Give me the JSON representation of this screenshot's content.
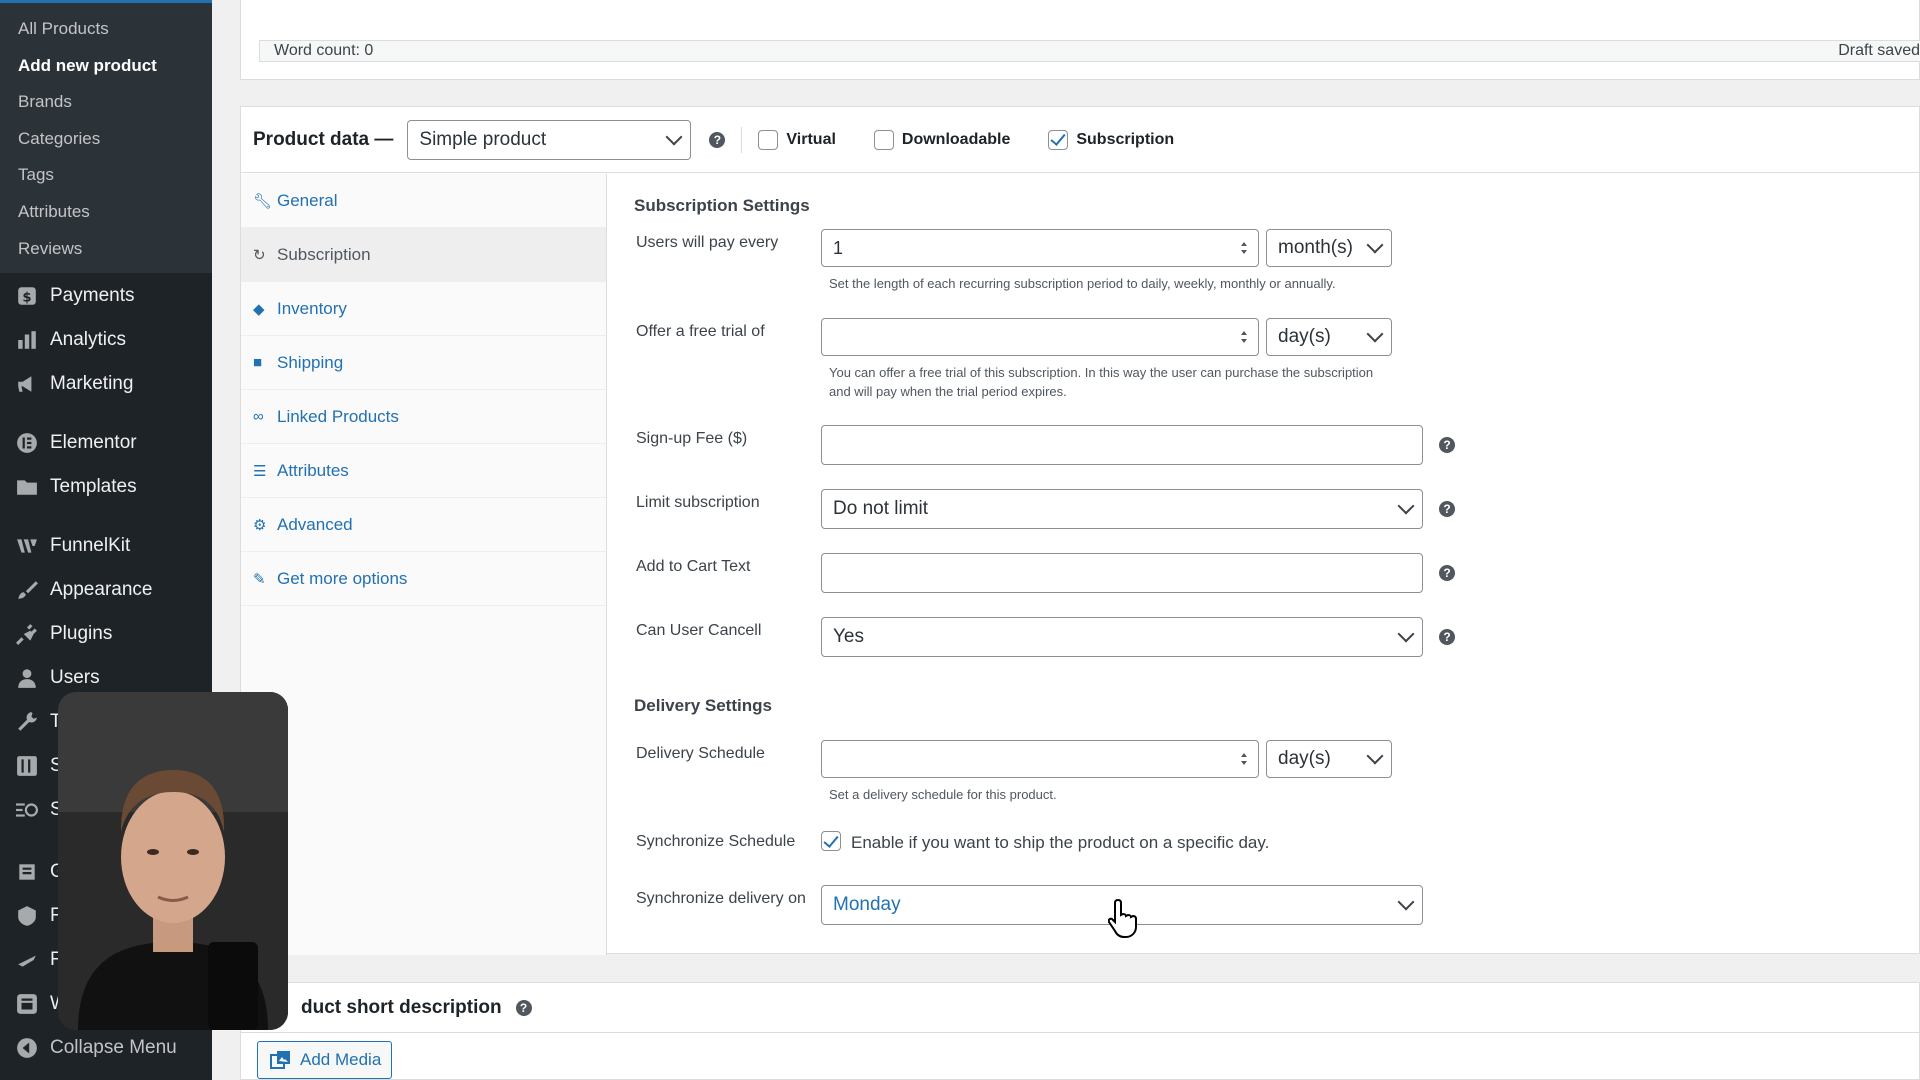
{
  "sidebar": {
    "submenu": [
      {
        "label": "All Products"
      },
      {
        "label": "Add new product"
      },
      {
        "label": "Brands"
      },
      {
        "label": "Categories"
      },
      {
        "label": "Tags"
      },
      {
        "label": "Attributes"
      },
      {
        "label": "Reviews"
      }
    ],
    "menu": [
      {
        "label": "Payments",
        "icon": "dollar-icon"
      },
      {
        "label": "Analytics",
        "icon": "bar-chart-icon"
      },
      {
        "label": "Marketing",
        "icon": "megaphone-icon"
      },
      {
        "label": "Elementor",
        "icon": "elementor-icon"
      },
      {
        "label": "Templates",
        "icon": "folder-icon"
      },
      {
        "label": "FunnelKit",
        "icon": "funnelkit-icon"
      },
      {
        "label": "Appearance",
        "icon": "paintbrush-icon"
      },
      {
        "label": "Plugins",
        "icon": "plug-icon"
      },
      {
        "label": "Users",
        "icon": "user-icon"
      },
      {
        "label": "T",
        "icon": "wrench-icon"
      },
      {
        "label": "S",
        "icon": "settings-icon"
      },
      {
        "label": "S",
        "icon": "toggle-icon"
      },
      {
        "label": "G",
        "icon": "g-icon"
      },
      {
        "label": "F",
        "icon": "f-icon"
      },
      {
        "label": "F",
        "icon": "feather-icon"
      },
      {
        "label": "W",
        "icon": "w-icon"
      },
      {
        "label": "Collapse Menu",
        "icon": "collapse-icon"
      }
    ]
  },
  "editor": {
    "word_count": "Word count: 0",
    "draft_status": "Draft saved"
  },
  "product_data": {
    "title": "Product data —",
    "product_type": "Simple product",
    "checkboxes": [
      {
        "label": "Virtual",
        "checked": false
      },
      {
        "label": "Downloadable",
        "checked": false
      },
      {
        "label": "Subscription",
        "checked": true
      }
    ],
    "tabs": [
      {
        "label": "General",
        "icon": "wrench-icon"
      },
      {
        "label": "Subscription",
        "icon": "refresh-icon"
      },
      {
        "label": "Inventory",
        "icon": "tag-icon"
      },
      {
        "label": "Shipping",
        "icon": "truck-icon"
      },
      {
        "label": "Linked Products",
        "icon": "link-icon"
      },
      {
        "label": "Attributes",
        "icon": "list-icon"
      },
      {
        "label": "Advanced",
        "icon": "gear-icon"
      },
      {
        "label": "Get more options",
        "icon": "plug-icon"
      }
    ],
    "active_tab": "Subscription"
  },
  "subscription": {
    "section_title": "Subscription Settings",
    "pay_every_label": "Users will pay every",
    "pay_every_value": "1",
    "pay_every_unit": "month(s)",
    "pay_every_desc": "Set the length of each recurring subscription period to daily, weekly, monthly or annually.",
    "trial_label": "Offer a free trial of",
    "trial_value": "",
    "trial_unit": "day(s)",
    "trial_desc_1": "You can offer a free trial of this subscription. In this way the user can purchase the subscription",
    "trial_desc_2": "and will pay when the trial period expires.",
    "signup_fee_label": "Sign-up Fee ($)",
    "signup_fee_value": "",
    "limit_label": "Limit subscription",
    "limit_value": "Do not limit",
    "cart_text_label": "Add to Cart Text",
    "cart_text_value": "",
    "cancel_label": "Can User Cancell",
    "cancel_value": "Yes"
  },
  "delivery": {
    "section_title": "Delivery Settings",
    "schedule_label": "Delivery Schedule",
    "schedule_value": "",
    "schedule_unit": "day(s)",
    "schedule_desc": "Set a delivery schedule for this product.",
    "sync_label": "Synchronize Schedule",
    "sync_checked": true,
    "sync_text": "Enable if you want to ship the product on a specific day.",
    "sync_on_label": "Synchronize delivery on",
    "sync_on_value": "Monday"
  },
  "short_description": {
    "title": "duct short description",
    "add_media": "Add Media"
  },
  "colors": {
    "sidebar_bg": "#1d2327",
    "accent": "#2271b1"
  }
}
